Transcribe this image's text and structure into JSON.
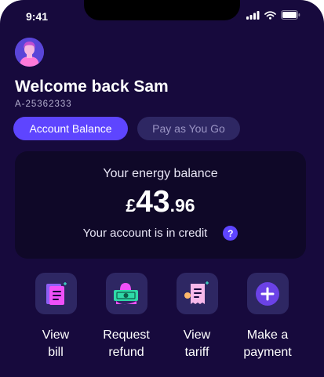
{
  "status_bar": {
    "time": "9:41"
  },
  "header": {
    "welcome": "Welcome back Sam",
    "account_number": "A-25362333"
  },
  "tabs": [
    {
      "label": "Account Balance",
      "active": true
    },
    {
      "label": "Pay as You Go",
      "active": false
    }
  ],
  "balance": {
    "label": "Your energy balance",
    "currency": "£",
    "amount_major": "43",
    "amount_minor": ".96",
    "status_text": "Your account is in credit",
    "help_glyph": "?"
  },
  "actions": [
    {
      "label": "View\nbill",
      "icon": "bill-icon"
    },
    {
      "label": "Request\nrefund",
      "icon": "refund-icon"
    },
    {
      "label": "View\ntariff",
      "icon": "tariff-icon"
    },
    {
      "label": "Make a\npayment",
      "icon": "plus-icon"
    }
  ],
  "colors": {
    "background": "#170a3d",
    "card": "#0f0828",
    "accent": "#5e45ff",
    "tile": "#2e2763",
    "icon_pink": "#f050f8"
  }
}
